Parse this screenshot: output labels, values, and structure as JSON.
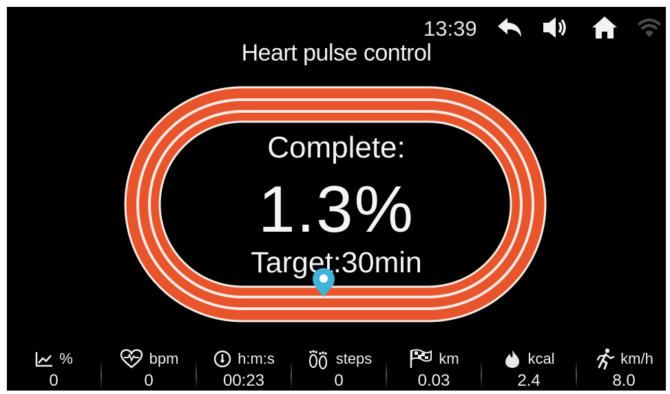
{
  "status_bar": {
    "time": "13:39",
    "icons": [
      "back-arrow-icon",
      "volume-icon",
      "home-icon",
      "wifi-icon"
    ]
  },
  "title": "Heart  pulse control",
  "progress": {
    "label": "Complete:",
    "value": "1.3%",
    "fraction": 0.013,
    "target": "Target:30min"
  },
  "colors": {
    "track": "#e8542c",
    "track_line": "#f3ece6",
    "pin": "#3fb4d8",
    "background": "#000000"
  },
  "stats": [
    {
      "icon": "chart-line-icon",
      "unit": "%",
      "value": "0"
    },
    {
      "icon": "heart-pulse-icon",
      "unit": "bpm",
      "value": "0"
    },
    {
      "icon": "timer-icon",
      "unit": "h:m:s",
      "value": "00:23"
    },
    {
      "icon": "footprints-icon",
      "unit": "steps",
      "value": "0"
    },
    {
      "icon": "checkered-flag-icon",
      "unit": "km",
      "value": "0.03"
    },
    {
      "icon": "flame-icon",
      "unit": "kcal",
      "value": "2.4"
    },
    {
      "icon": "runner-icon",
      "unit": "km/h",
      "value": "8.0"
    }
  ]
}
